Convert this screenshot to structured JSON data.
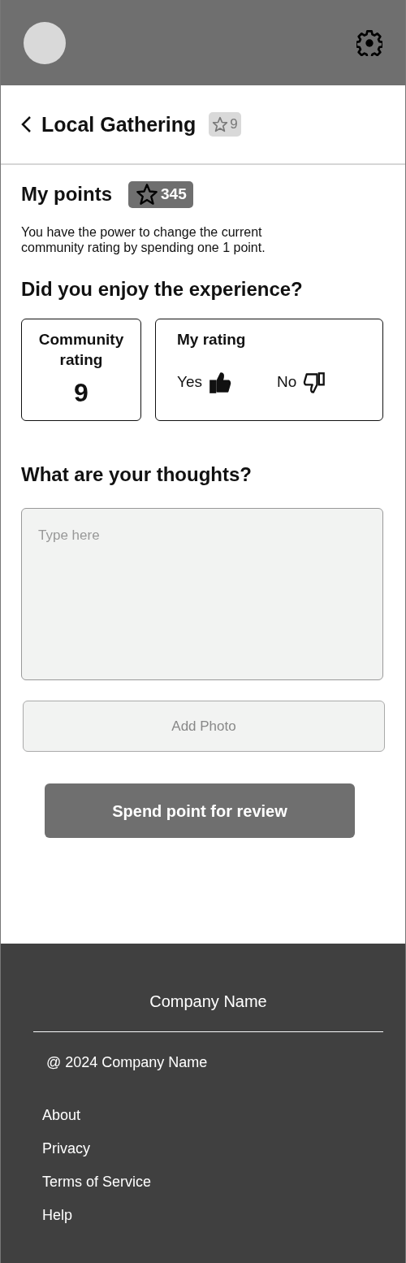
{
  "title_bar": {
    "title": "Local Gathering",
    "rating_badge": "9"
  },
  "points": {
    "heading": "My points",
    "badge": "345",
    "note": "You have the power to change the current community rating by spending one 1 point."
  },
  "experience": {
    "heading": "Did you enjoy the experience?",
    "community": {
      "label": "Community rating",
      "value": "9"
    },
    "my_rating": {
      "label": "My rating",
      "options": [
        {
          "label": "Yes",
          "kind": "up",
          "selected": true
        },
        {
          "label": "No",
          "kind": "down",
          "selected": false
        }
      ]
    }
  },
  "thoughts": {
    "heading": "What are your thoughts?",
    "placeholder": "Type here"
  },
  "add_photo": "Add Photo",
  "submit": "Spend point for review",
  "footer": {
    "brand": "Company Name",
    "copyright": "@ 2024 Company Name",
    "links": [
      "About",
      "Privacy",
      "Terms of Service",
      "Help"
    ]
  }
}
